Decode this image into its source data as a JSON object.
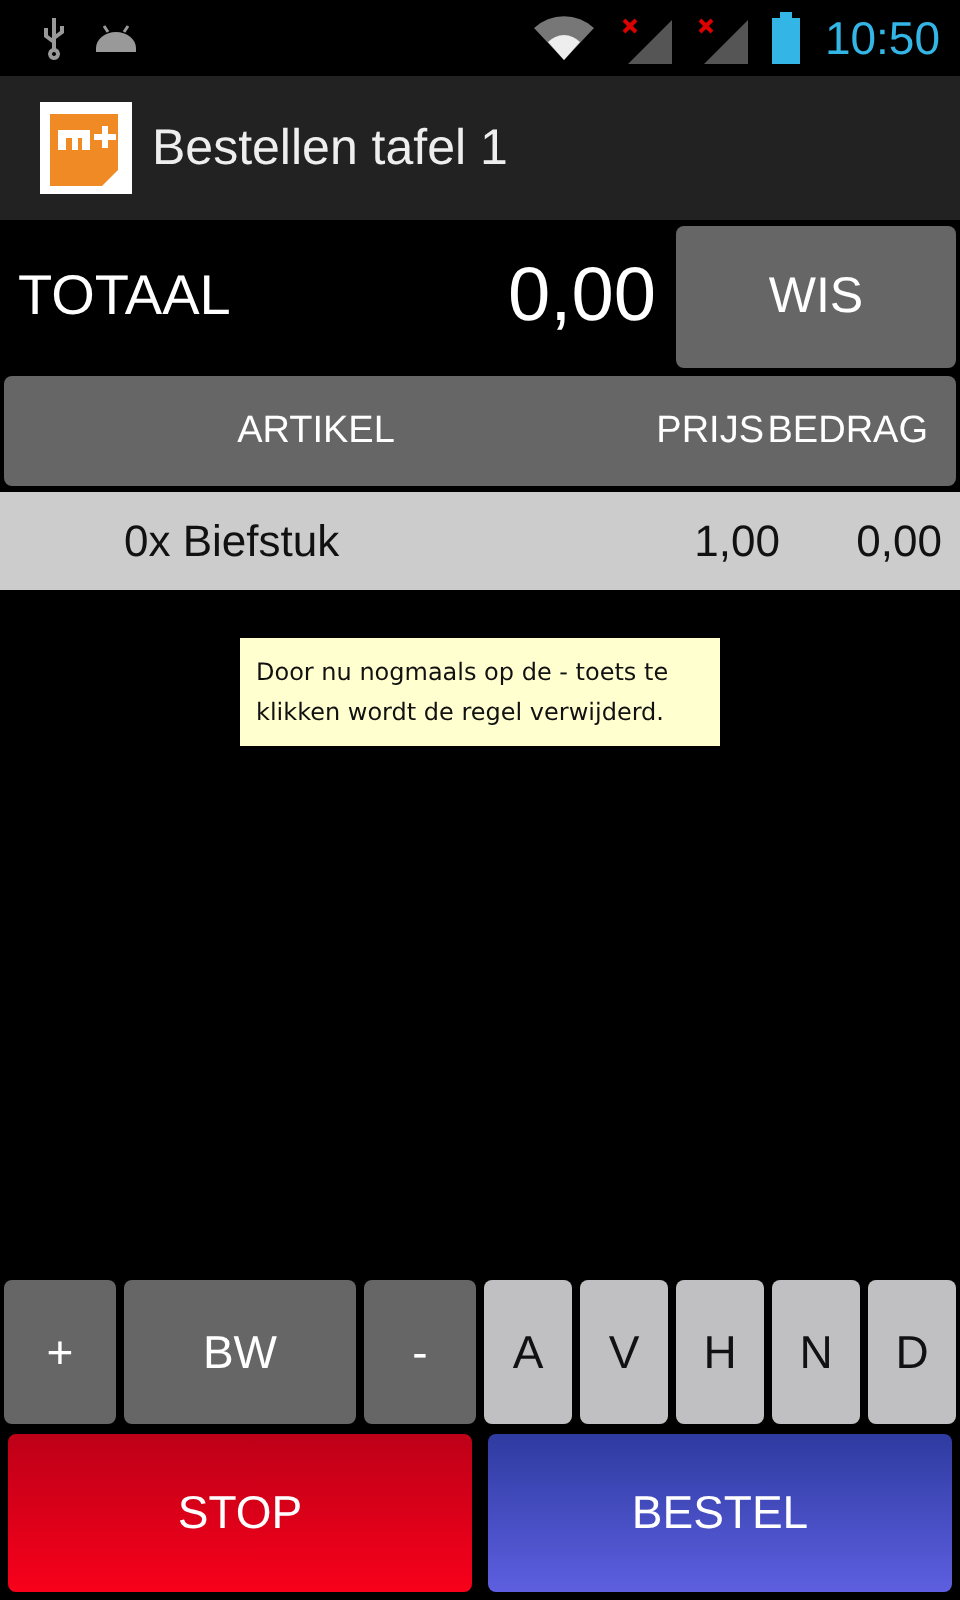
{
  "status_bar": {
    "time": "10:50"
  },
  "app_bar": {
    "title": "Bestellen tafel 1"
  },
  "total": {
    "label": "TOTAAL",
    "amount": "0,00",
    "clear_button": "WIS"
  },
  "table": {
    "columns": [
      "ARTIKEL",
      "PRIJS",
      "BEDRAG"
    ],
    "rows": [
      {
        "item": "0x Biefstuk",
        "price": "1,00",
        "amount": "0,00"
      }
    ]
  },
  "toast": "Door nu nogmaals op de - toets te klikken wordt de regel verwijderd.",
  "keypad": [
    {
      "label": "+",
      "kind": "dark"
    },
    {
      "label": "BW",
      "kind": "dark"
    },
    {
      "label": "-",
      "kind": "dark"
    },
    {
      "label": "A",
      "kind": "light"
    },
    {
      "label": "V",
      "kind": "light"
    },
    {
      "label": "H",
      "kind": "light"
    },
    {
      "label": "N",
      "kind": "light"
    },
    {
      "label": "D",
      "kind": "light"
    }
  ],
  "actions": [
    {
      "label": "STOP",
      "kind": "stop"
    },
    {
      "label": "BESTEL",
      "kind": "order"
    }
  ]
}
